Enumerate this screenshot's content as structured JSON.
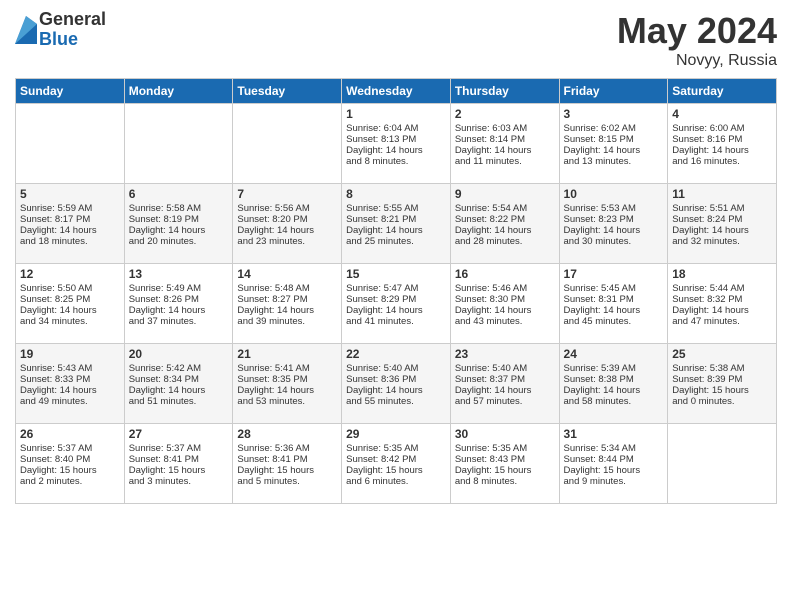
{
  "header": {
    "logo_general": "General",
    "logo_blue": "Blue",
    "month": "May 2024",
    "location": "Novyy, Russia"
  },
  "days_of_week": [
    "Sunday",
    "Monday",
    "Tuesday",
    "Wednesday",
    "Thursday",
    "Friday",
    "Saturday"
  ],
  "weeks": [
    [
      {
        "day": "",
        "content": ""
      },
      {
        "day": "",
        "content": ""
      },
      {
        "day": "",
        "content": ""
      },
      {
        "day": "1",
        "content": "Sunrise: 6:04 AM\nSunset: 8:13 PM\nDaylight: 14 hours\nand 8 minutes."
      },
      {
        "day": "2",
        "content": "Sunrise: 6:03 AM\nSunset: 8:14 PM\nDaylight: 14 hours\nand 11 minutes."
      },
      {
        "day": "3",
        "content": "Sunrise: 6:02 AM\nSunset: 8:15 PM\nDaylight: 14 hours\nand 13 minutes."
      },
      {
        "day": "4",
        "content": "Sunrise: 6:00 AM\nSunset: 8:16 PM\nDaylight: 14 hours\nand 16 minutes."
      }
    ],
    [
      {
        "day": "5",
        "content": "Sunrise: 5:59 AM\nSunset: 8:17 PM\nDaylight: 14 hours\nand 18 minutes."
      },
      {
        "day": "6",
        "content": "Sunrise: 5:58 AM\nSunset: 8:19 PM\nDaylight: 14 hours\nand 20 minutes."
      },
      {
        "day": "7",
        "content": "Sunrise: 5:56 AM\nSunset: 8:20 PM\nDaylight: 14 hours\nand 23 minutes."
      },
      {
        "day": "8",
        "content": "Sunrise: 5:55 AM\nSunset: 8:21 PM\nDaylight: 14 hours\nand 25 minutes."
      },
      {
        "day": "9",
        "content": "Sunrise: 5:54 AM\nSunset: 8:22 PM\nDaylight: 14 hours\nand 28 minutes."
      },
      {
        "day": "10",
        "content": "Sunrise: 5:53 AM\nSunset: 8:23 PM\nDaylight: 14 hours\nand 30 minutes."
      },
      {
        "day": "11",
        "content": "Sunrise: 5:51 AM\nSunset: 8:24 PM\nDaylight: 14 hours\nand 32 minutes."
      }
    ],
    [
      {
        "day": "12",
        "content": "Sunrise: 5:50 AM\nSunset: 8:25 PM\nDaylight: 14 hours\nand 34 minutes."
      },
      {
        "day": "13",
        "content": "Sunrise: 5:49 AM\nSunset: 8:26 PM\nDaylight: 14 hours\nand 37 minutes."
      },
      {
        "day": "14",
        "content": "Sunrise: 5:48 AM\nSunset: 8:27 PM\nDaylight: 14 hours\nand 39 minutes."
      },
      {
        "day": "15",
        "content": "Sunrise: 5:47 AM\nSunset: 8:29 PM\nDaylight: 14 hours\nand 41 minutes."
      },
      {
        "day": "16",
        "content": "Sunrise: 5:46 AM\nSunset: 8:30 PM\nDaylight: 14 hours\nand 43 minutes."
      },
      {
        "day": "17",
        "content": "Sunrise: 5:45 AM\nSunset: 8:31 PM\nDaylight: 14 hours\nand 45 minutes."
      },
      {
        "day": "18",
        "content": "Sunrise: 5:44 AM\nSunset: 8:32 PM\nDaylight: 14 hours\nand 47 minutes."
      }
    ],
    [
      {
        "day": "19",
        "content": "Sunrise: 5:43 AM\nSunset: 8:33 PM\nDaylight: 14 hours\nand 49 minutes."
      },
      {
        "day": "20",
        "content": "Sunrise: 5:42 AM\nSunset: 8:34 PM\nDaylight: 14 hours\nand 51 minutes."
      },
      {
        "day": "21",
        "content": "Sunrise: 5:41 AM\nSunset: 8:35 PM\nDaylight: 14 hours\nand 53 minutes."
      },
      {
        "day": "22",
        "content": "Sunrise: 5:40 AM\nSunset: 8:36 PM\nDaylight: 14 hours\nand 55 minutes."
      },
      {
        "day": "23",
        "content": "Sunrise: 5:40 AM\nSunset: 8:37 PM\nDaylight: 14 hours\nand 57 minutes."
      },
      {
        "day": "24",
        "content": "Sunrise: 5:39 AM\nSunset: 8:38 PM\nDaylight: 14 hours\nand 58 minutes."
      },
      {
        "day": "25",
        "content": "Sunrise: 5:38 AM\nSunset: 8:39 PM\nDaylight: 15 hours\nand 0 minutes."
      }
    ],
    [
      {
        "day": "26",
        "content": "Sunrise: 5:37 AM\nSunset: 8:40 PM\nDaylight: 15 hours\nand 2 minutes."
      },
      {
        "day": "27",
        "content": "Sunrise: 5:37 AM\nSunset: 8:41 PM\nDaylight: 15 hours\nand 3 minutes."
      },
      {
        "day": "28",
        "content": "Sunrise: 5:36 AM\nSunset: 8:41 PM\nDaylight: 15 hours\nand 5 minutes."
      },
      {
        "day": "29",
        "content": "Sunrise: 5:35 AM\nSunset: 8:42 PM\nDaylight: 15 hours\nand 6 minutes."
      },
      {
        "day": "30",
        "content": "Sunrise: 5:35 AM\nSunset: 8:43 PM\nDaylight: 15 hours\nand 8 minutes."
      },
      {
        "day": "31",
        "content": "Sunrise: 5:34 AM\nSunset: 8:44 PM\nDaylight: 15 hours\nand 9 minutes."
      },
      {
        "day": "",
        "content": ""
      }
    ]
  ]
}
